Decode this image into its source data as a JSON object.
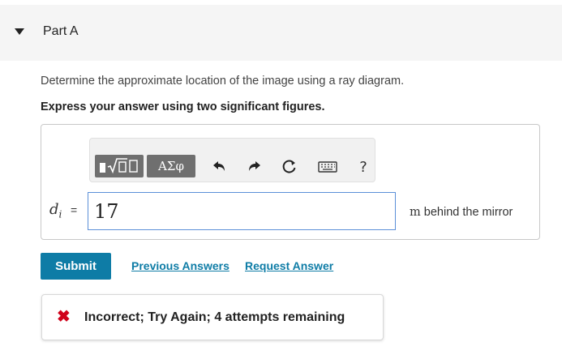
{
  "part": {
    "title": "Part A"
  },
  "question": {
    "text": "Determine the approximate location of the image using a ray diagram.",
    "instruction": "Express your answer using two significant figures."
  },
  "toolbar": {
    "templates_icon": "sqrt-template-icon",
    "greek_label": "ΑΣφ",
    "undo_icon": "undo-icon",
    "redo_icon": "redo-icon",
    "reset_icon": "reset-icon",
    "keyboard_icon": "keyboard-icon",
    "help_label": "?"
  },
  "answer": {
    "variable": "d",
    "subscript": "i",
    "equals": "=",
    "value": "17",
    "unit": "m",
    "unit_suffix": " behind the mirror"
  },
  "actions": {
    "submit": "Submit",
    "previous_answers": "Previous Answers",
    "request_answer": "Request Answer"
  },
  "feedback": {
    "icon": "x-icon",
    "text": "Incorrect; Try Again; 4 attempts remaining",
    "color": "#d0021b"
  }
}
